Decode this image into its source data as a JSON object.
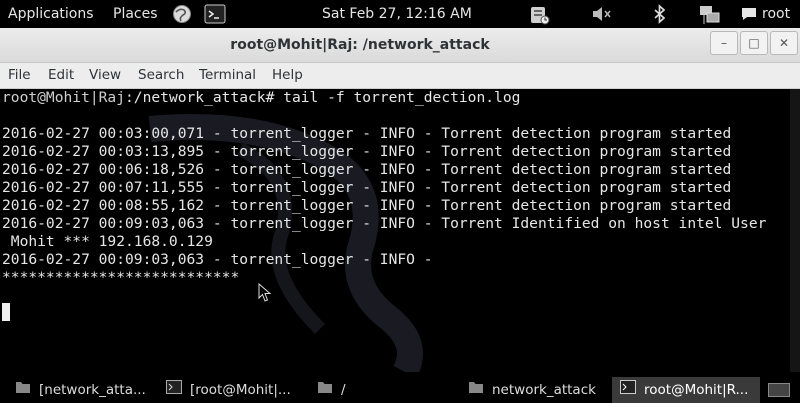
{
  "top_panel": {
    "applications": "Applications",
    "places": "Places",
    "clock": "Sat Feb 27, 12:16 AM",
    "user": "root",
    "icons": [
      "browser-globe-icon",
      "terminal-icon",
      "notification-icon",
      "volume-icon",
      "bluetooth-icon",
      "network-icon",
      "chat-icon"
    ]
  },
  "window": {
    "title": "root@Mohit|Raj: /network_attack",
    "buttons": {
      "minimize": "–",
      "maximize": "□",
      "close": "✕"
    }
  },
  "menubar": [
    "File",
    "Edit",
    "View",
    "Search",
    "Terminal",
    "Help"
  ],
  "terminal": {
    "prompt": "root@Mohit|Raj",
    "cwd": ":/network_attack#",
    "command": " tail -f torrent_dection.log",
    "lines": [
      "",
      "2016-02-27 00:03:00,071 - torrent_logger - INFO - Torrent detection program started",
      "2016-02-27 00:03:13,895 - torrent_logger - INFO - Torrent detection program started",
      "2016-02-27 00:06:18,526 - torrent_logger - INFO - Torrent detection program started",
      "2016-02-27 00:07:11,555 - torrent_logger - INFO - Torrent detection program started",
      "2016-02-27 00:08:55,162 - torrent_logger - INFO - Torrent detection program started",
      "2016-02-27 00:09:03,063 - torrent_logger - INFO - Torrent Identified on host intel User",
      " Mohit *** 192.168.0.129",
      "2016-02-27 00:09:03,063 - torrent_logger - INFO -",
      "***************************"
    ]
  },
  "taskbar": [
    {
      "label": "[network_atta...",
      "icon": "folder-icon",
      "active": false
    },
    {
      "label": "[root@Mohit|...",
      "icon": "terminal-icon",
      "active": false
    },
    {
      "label": "/",
      "icon": "folder-icon",
      "active": false
    },
    {
      "label": "network_attack",
      "icon": "folder-icon",
      "active": false
    },
    {
      "label": "root@Mohit|R...",
      "icon": "terminal-icon",
      "active": true
    }
  ]
}
